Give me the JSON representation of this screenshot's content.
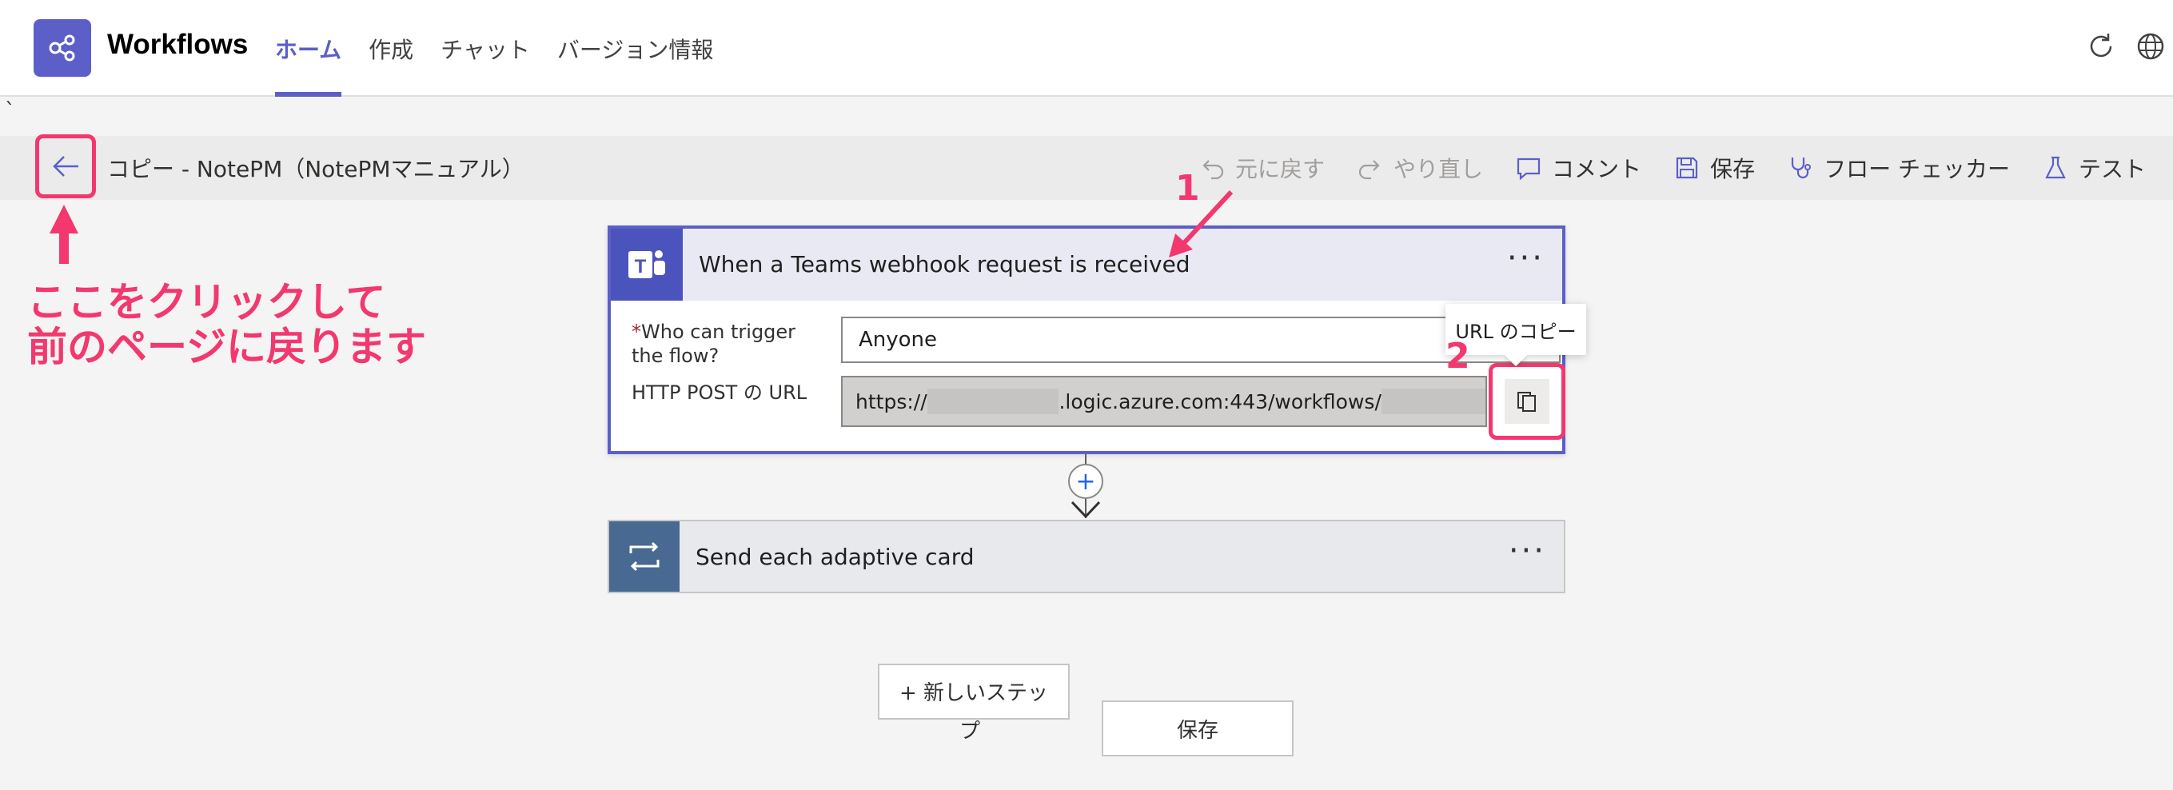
{
  "app": {
    "title": "Workflows",
    "accent_color": "#5b5fc7",
    "nav": [
      {
        "label": "ホーム",
        "active": true
      },
      {
        "label": "作成",
        "active": false
      },
      {
        "label": "チャット",
        "active": false
      },
      {
        "label": "バージョン情報",
        "active": false
      }
    ],
    "icons": [
      "refresh-icon",
      "globe-icon"
    ]
  },
  "stray_char": "`",
  "commandbar": {
    "flow_name": "コピー - NotePM（NotePMマニュアル）",
    "undo": "元に戻す",
    "redo": "やり直し",
    "comment": "コメント",
    "save": "保存",
    "flow_checker": "フロー チェッカー",
    "test": "テスト"
  },
  "trigger_card": {
    "title": "When a Teams webhook request is received",
    "more": "···",
    "who_label": "Who can trigger the flow?",
    "who_required_mark": "*",
    "who_value": "Anyone",
    "url_label": "HTTP POST の URL",
    "url_prefix": "https://",
    "url_middle": ".logic.azure.com:443/workflows/",
    "copy_tooltip": "URL のコピー"
  },
  "action_card": {
    "title": "Send each adaptive card",
    "more": "···"
  },
  "connector": {
    "plus": "+"
  },
  "footer": {
    "new_step": "+ 新しいステッ",
    "new_step_overflow": "プ",
    "save": "保存"
  },
  "annotations": {
    "back_hint_line1": "ここをクリックして",
    "back_hint_line2": "前のページに戻ります",
    "num1": "1",
    "num2": "2",
    "color": "#f2386e"
  }
}
